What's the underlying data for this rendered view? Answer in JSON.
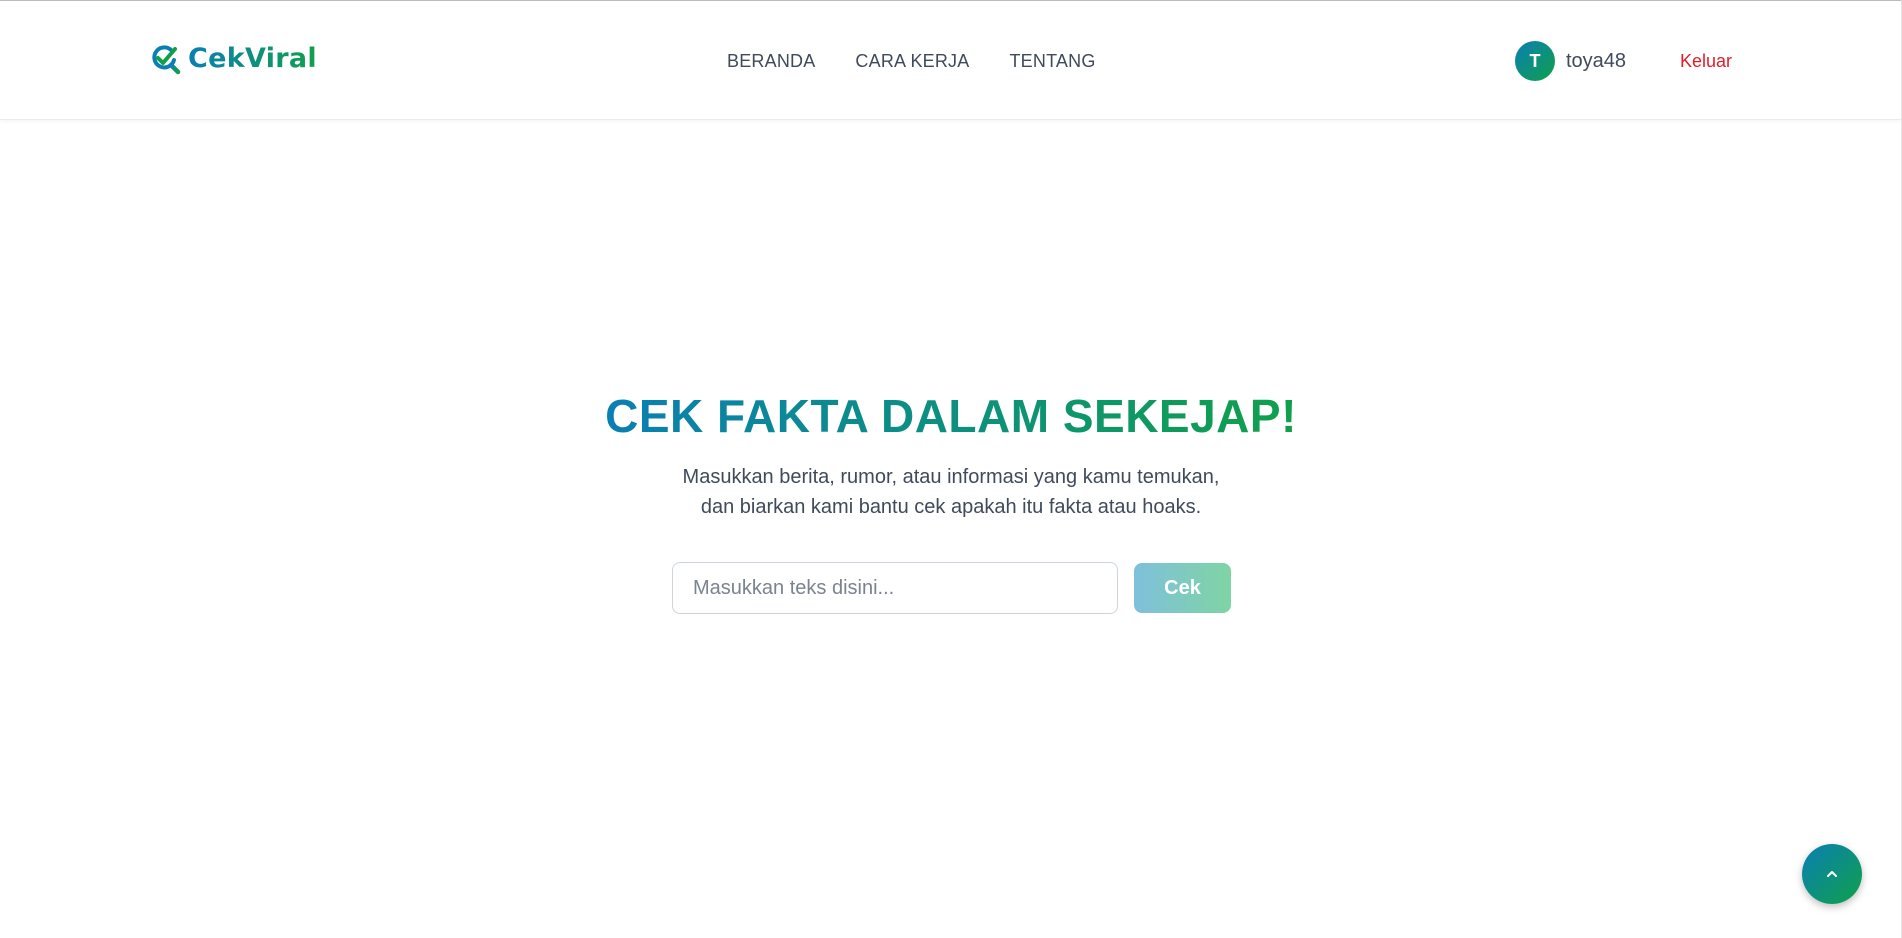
{
  "header": {
    "logo_text": "CekViral",
    "nav": [
      {
        "label": "BERANDA"
      },
      {
        "label": "CARA KERJA"
      },
      {
        "label": "TENTANG"
      }
    ],
    "user": {
      "initial": "T",
      "username": "toya48"
    },
    "logout_label": "Keluar"
  },
  "hero": {
    "title": "CEK FAKTA DALAM SEKEJAP!",
    "subtitle_line1": "Masukkan berita, rumor, atau informasi yang kamu temukan,",
    "subtitle_line2": "dan biarkan kami bantu cek apakah itu fakta atau hoaks.",
    "input_placeholder": "Masukkan teks disini...",
    "input_value": "",
    "button_label": "Cek"
  },
  "icons": {
    "logo": "check-search-icon",
    "scroll_top": "chevron-up-icon"
  },
  "colors": {
    "gradient_start": "#0a7fb3",
    "gradient_end": "#10a04a",
    "logout": "#e11d2a",
    "text": "#3f4a5a"
  }
}
